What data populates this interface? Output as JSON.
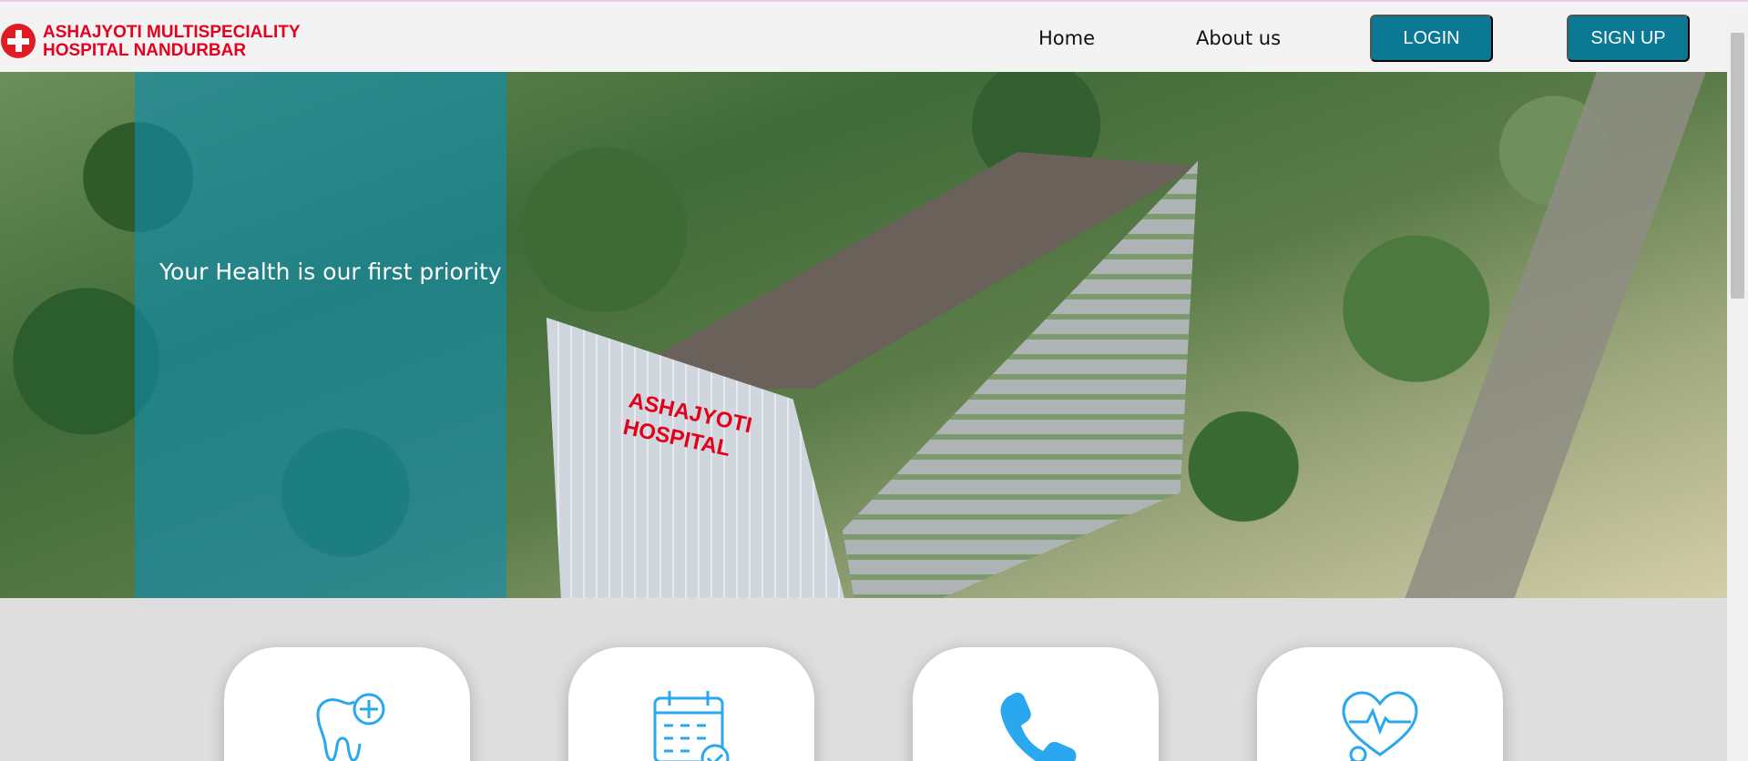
{
  "header": {
    "brand_line1": "ASHAJYOTI MULTISPECIALITY",
    "brand_line2": "HOSPITAL NANDURBAR",
    "logo_icon": "red-cross-icon",
    "nav": {
      "home": "Home",
      "about": "About us"
    },
    "login_label": "LOGIN",
    "signup_label": "SIGN UP"
  },
  "hero": {
    "tagline": "Your Health is our first priority",
    "building_sign_line1": "ASHAJYOTI",
    "building_sign_line2": "HOSPITAL"
  },
  "services": [
    {
      "icon": "dental-care-icon"
    },
    {
      "icon": "calendar-appointment-icon"
    },
    {
      "icon": "phone-icon"
    },
    {
      "icon": "heart-checkup-icon"
    }
  ],
  "colors": {
    "brand_red": "#e6001e",
    "button_teal": "#0b7894",
    "panel_teal": "#0e8eb2",
    "icon_blue": "#29a8f0"
  }
}
